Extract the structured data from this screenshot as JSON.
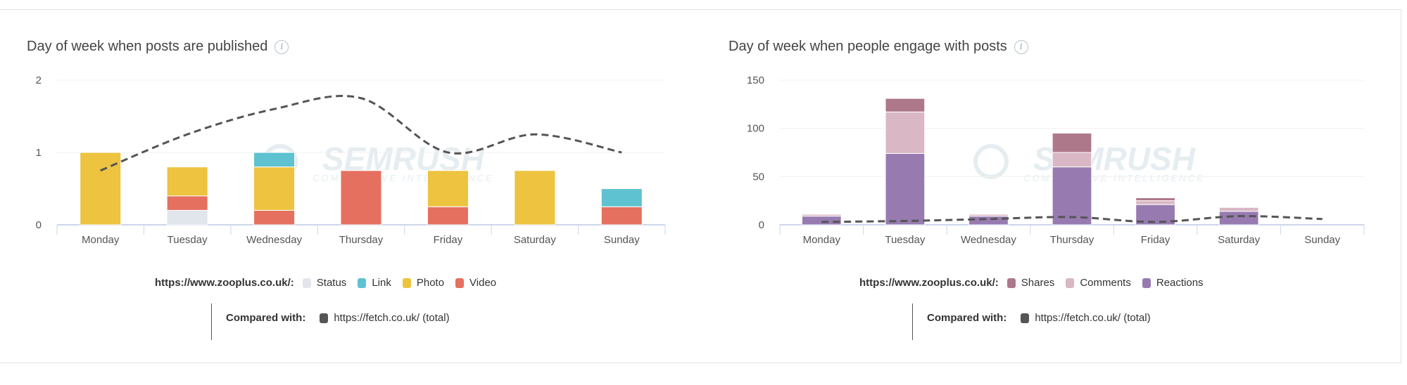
{
  "watermark": {
    "brand": "SEMRUSH",
    "tagline": "COMPETITIVE INTELLIGENCE"
  },
  "chart_data": [
    {
      "type": "bar",
      "stacked": true,
      "title": "Day of week when posts are published",
      "categories": [
        "Monday",
        "Tuesday",
        "Wednesday",
        "Thursday",
        "Friday",
        "Saturday",
        "Sunday"
      ],
      "ylim": [
        0,
        2
      ],
      "yticks": [
        0,
        1,
        2
      ],
      "grid": true,
      "legend_label": "https://www.zooplus.co.uk/:",
      "series": [
        {
          "name": "Status",
          "color": "#e1e5ec",
          "values": [
            0,
            0.2,
            0,
            0,
            0,
            0,
            0
          ]
        },
        {
          "name": "Link",
          "color": "#5fc2d0",
          "values": [
            0,
            0,
            0.2,
            0,
            0,
            0,
            0.25
          ]
        },
        {
          "name": "Photo",
          "color": "#edc33f",
          "values": [
            1,
            0.4,
            0.6,
            0,
            0.5,
            0.75,
            0
          ]
        },
        {
          "name": "Video",
          "color": "#e57060",
          "values": [
            0,
            0.2,
            0.2,
            0.75,
            0.25,
            0,
            0.25
          ]
        }
      ],
      "stack_order": [
        "Status",
        "Video",
        "Photo",
        "Link"
      ],
      "comparison": {
        "label": "Compared with:",
        "name": "https://fetch.co.uk/ (total)",
        "color": "#555555",
        "style": "dashed",
        "values": [
          0.75,
          1.25,
          1.6,
          1.75,
          1.0,
          1.25,
          1.0
        ]
      }
    },
    {
      "type": "bar",
      "stacked": true,
      "title": "Day of week when people engage with posts",
      "categories": [
        "Monday",
        "Tuesday",
        "Wednesday",
        "Thursday",
        "Friday",
        "Saturday",
        "Sunday"
      ],
      "ylim": [
        0,
        150
      ],
      "yticks": [
        0,
        50,
        100,
        150
      ],
      "grid": true,
      "legend_label": "https://www.zooplus.co.uk/:",
      "series": [
        {
          "name": "Shares",
          "color": "#ad7889",
          "values": [
            0.5,
            14,
            0.5,
            20,
            3,
            0,
            0
          ]
        },
        {
          "name": "Comments",
          "color": "#d9b7c4",
          "values": [
            2,
            43,
            2,
            15,
            4,
            4,
            0
          ]
        },
        {
          "name": "Reactions",
          "color": "#977bb0",
          "values": [
            9,
            74,
            9,
            60,
            21,
            14,
            0
          ]
        }
      ],
      "stack_order": [
        "Reactions",
        "Comments",
        "Shares"
      ],
      "comparison": {
        "label": "Compared with:",
        "name": "https://fetch.co.uk/ (total)",
        "color": "#555555",
        "style": "dashed",
        "values": [
          3,
          4,
          6,
          8,
          3,
          9,
          6
        ]
      }
    }
  ]
}
